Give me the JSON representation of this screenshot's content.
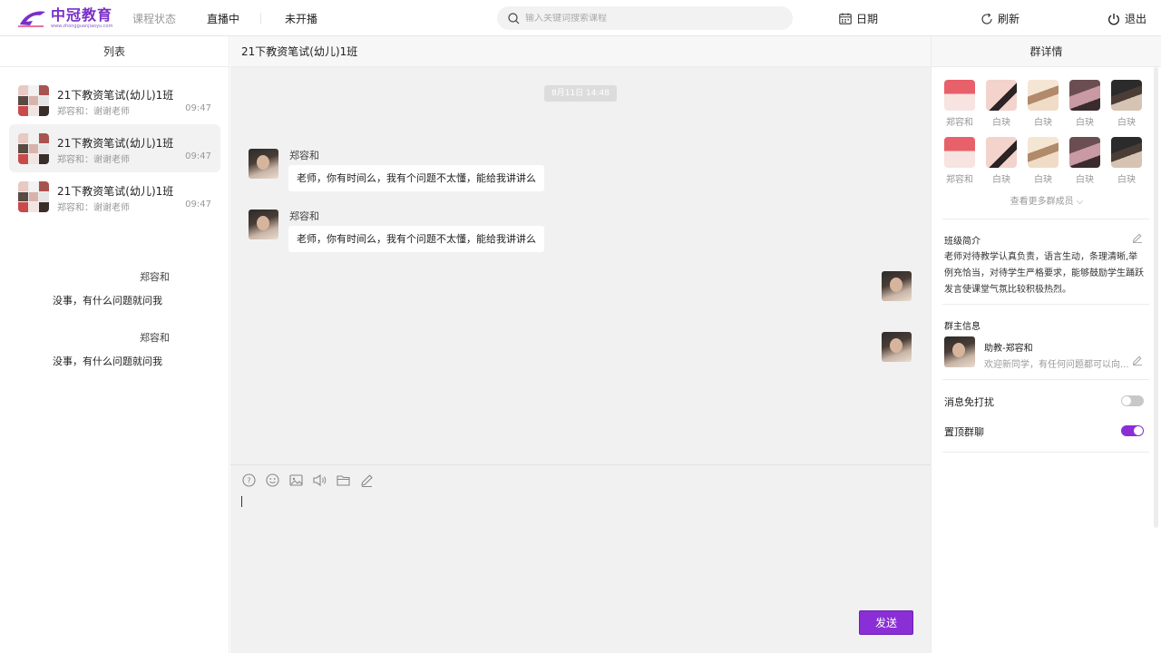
{
  "topbar": {
    "logo_text": "中冠教育",
    "logo_subtext": "www.zhongguanjiaoyu.com",
    "nav": [
      "课程状态",
      "直播中",
      "未开播"
    ],
    "search_placeholder": "输入关键词搜索课程",
    "actions": {
      "date": "日期",
      "refresh": "刷新",
      "exit": "退出"
    }
  },
  "left": {
    "header": "列表",
    "conversations": [
      {
        "title": "21下教资笔试(幼儿)1班",
        "preview": "郑容和：谢谢老师",
        "time": "09:47",
        "active": false
      },
      {
        "title": "21下教资笔试(幼儿)1班",
        "preview": "郑容和：谢谢老师",
        "time": "09:47",
        "active": true
      },
      {
        "title": "21下教资笔试(幼儿)1班",
        "preview": "郑容和：谢谢老师",
        "time": "09:47",
        "active": false
      }
    ]
  },
  "chat": {
    "title": "21下教资笔试(幼儿)1班",
    "time_divider": "8月11日  14:48",
    "messages": [
      {
        "side": "left",
        "name": "郑容和",
        "text": "老师，你有时间么，我有个问题不太懂，能给我讲讲么"
      },
      {
        "side": "left",
        "name": "郑容和",
        "text": "老师，你有时间么，我有个问题不太懂，能给我讲讲么"
      },
      {
        "side": "right",
        "name": "郑容和",
        "text": "没事，有什么问题就问我"
      },
      {
        "side": "right",
        "name": "郑容和",
        "text": "没事，有什么问题就问我"
      }
    ],
    "tools": [
      "question-icon",
      "emoji-icon",
      "image-icon",
      "voice-icon",
      "folder-icon",
      "edit-icon"
    ],
    "send_label": "发送"
  },
  "right": {
    "header": "群详情",
    "members": [
      {
        "name": "郑容和"
      },
      {
        "name": "白玦"
      },
      {
        "name": "白玦"
      },
      {
        "name": "白玦"
      },
      {
        "name": "白玦"
      },
      {
        "name": "郑容和"
      },
      {
        "name": "白玦"
      },
      {
        "name": "白玦"
      },
      {
        "name": "白玦"
      },
      {
        "name": "白玦"
      }
    ],
    "more_members": "查看更多群成员  ⌵",
    "intro_title": "班级简介",
    "intro_text": "老师对待教学认真负责，语言生动，条理清晰,举例充恰当，对待学生严格要求，能够鼓励学生踊跃发言使课堂气氛比较积极热烈。",
    "owner_title": "群主信息",
    "owner_name": "助教-郑容和",
    "owner_desc": "欢迎新同学，有任何问题都可以向...",
    "settings": [
      {
        "label": "消息免打扰",
        "on": false
      },
      {
        "label": "置顶群聊",
        "on": true
      }
    ]
  },
  "colors": {
    "accent": "#8a2fd6",
    "logo": "#7a2fc8",
    "bg_chat": "#f1f1f1"
  }
}
